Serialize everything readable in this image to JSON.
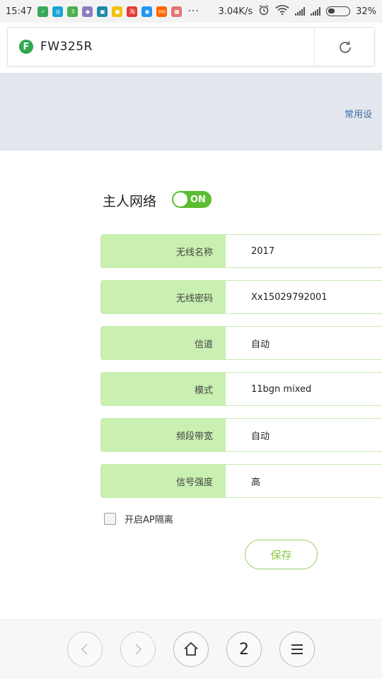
{
  "status_bar": {
    "time": "15:47",
    "network_speed": "3.04K/s",
    "battery": "32%",
    "battery_level": 0.32,
    "notification_icons": [
      {
        "name": "wechat-icon",
        "color": "#3aa757",
        "glyph": "✓"
      },
      {
        "name": "browser-icon",
        "color": "#1aa3d8",
        "glyph": "◎"
      },
      {
        "name": "app-3-icon",
        "color": "#4caf50",
        "glyph": "3"
      },
      {
        "name": "app-purple-icon",
        "color": "#8e7cc3",
        "glyph": "◆"
      },
      {
        "name": "app-teal-icon",
        "color": "#1e88a8",
        "glyph": "▣"
      },
      {
        "name": "app-yellow-icon",
        "color": "#f4c20d",
        "glyph": "●"
      },
      {
        "name": "app-red-icon",
        "color": "#e53935",
        "glyph": "淘"
      },
      {
        "name": "app-blue-icon",
        "color": "#2196f3",
        "glyph": "◉"
      },
      {
        "name": "mi-icon",
        "color": "#ff6700",
        "glyph": "mi"
      },
      {
        "name": "gallery-icon",
        "color": "#e57373",
        "glyph": "▦"
      }
    ]
  },
  "browser": {
    "url_title": "FW325R",
    "site_icon_letter": "F"
  },
  "header": {
    "common_settings_link": "常用设"
  },
  "main": {
    "title": "主人网络",
    "toggle_label": "ON",
    "fields": [
      {
        "label": "无线名称",
        "value": "2017"
      },
      {
        "label": "无线密码",
        "value": "Xx15029792001"
      },
      {
        "label": "信道",
        "value": "自动"
      },
      {
        "label": "模式",
        "value": "11bgn mixed"
      },
      {
        "label": "频段带宽",
        "value": "自动"
      },
      {
        "label": "信号强度",
        "value": "高"
      }
    ],
    "ap_isolation_label": "开启AP隔离",
    "save_label": "保存"
  },
  "bottom_nav": {
    "tab_count": "2"
  },
  "colors": {
    "accent_green": "#5bbd2f",
    "label_bg": "#c9efb1",
    "header_bg": "#e4e6ee",
    "link_blue": "#3a6ea5"
  }
}
